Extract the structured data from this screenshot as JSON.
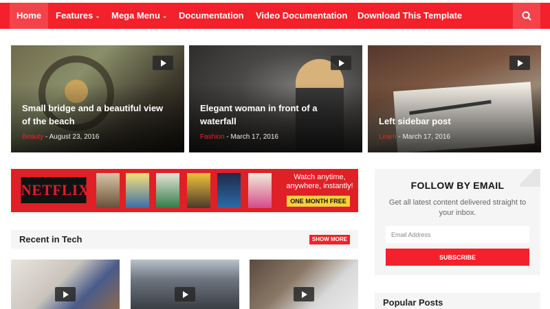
{
  "nav": {
    "items": [
      {
        "label": "Home"
      },
      {
        "label": "Features"
      },
      {
        "label": "Mega Menu"
      },
      {
        "label": "Documentation"
      },
      {
        "label": "Video Documentation"
      },
      {
        "label": "Download This Template"
      }
    ],
    "search_icon": "search-icon"
  },
  "featured": [
    {
      "title": "Small bridge and a beautiful view of the beach",
      "category": "Beauty",
      "date": "August 23, 2016"
    },
    {
      "title": "Elegant woman in front of a waterfall",
      "category": "Fashion",
      "date": "March 17, 2016"
    },
    {
      "title": "Left sidebar post",
      "category": "Learn",
      "date": "March 17, 2016"
    }
  ],
  "banner": {
    "logo": "NETFLIX",
    "tagline": "Watch anytime, anywhere, instantly!",
    "cta": "ONE MONTH FREE"
  },
  "recent": {
    "title": "Recent in Tech",
    "show_more": "SHOW MORE"
  },
  "sidebar": {
    "follow_title": "FOLLOW BY EMAIL",
    "follow_desc": "Get all latest content delivered straight to your inbox.",
    "email_placeholder": "Email Address",
    "subscribe": "SUBSCRIBE",
    "popular_title": "Popular Posts"
  },
  "colors": {
    "accent": "#f2212b",
    "nav_active": "#f4434b",
    "panel": "#f5f5f5"
  }
}
